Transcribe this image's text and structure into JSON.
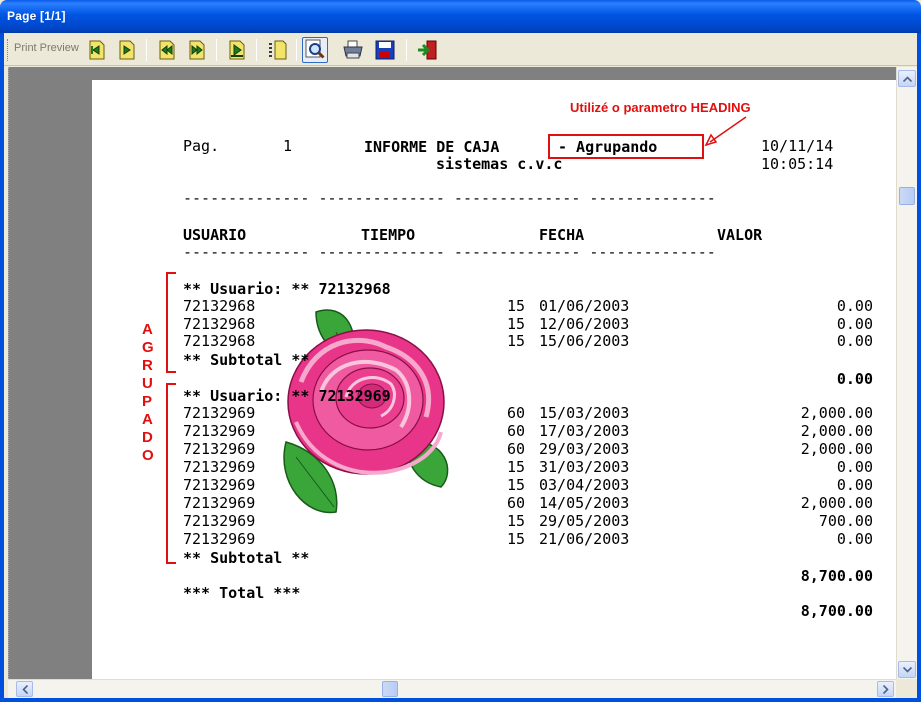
{
  "window": {
    "title": "Page [1/1]"
  },
  "toolbar": {
    "label": "Print Preview",
    "buttons": [
      {
        "name": "first-page-button",
        "icon": "page-first-icon"
      },
      {
        "name": "prev-page-button",
        "icon": "page-prev-icon"
      },
      {
        "name": "rewind-button",
        "icon": "rewind-icon"
      },
      {
        "name": "fast-forward-button",
        "icon": "fast-forward-icon"
      },
      {
        "name": "goto-page-button",
        "icon": "goto-page-icon"
      },
      {
        "name": "two-pages-button",
        "icon": "two-pages-icon"
      },
      {
        "name": "zoom-button",
        "icon": "magnifier-icon"
      },
      {
        "name": "print-button",
        "icon": "printer-icon"
      },
      {
        "name": "save-button",
        "icon": "floppy-disk-icon"
      },
      {
        "name": "exit-button",
        "icon": "exit-icon"
      }
    ]
  },
  "report": {
    "pag_label": "Pag.",
    "pag_number": "1",
    "title_prefix": "INFORME DE CAJA",
    "title_heading": "- Agrupando",
    "subtitle": "sistemas c.v.c",
    "date": "10/11/14",
    "time": "10:05:14",
    "dashes": "-------------- -------------- -------------- --------------",
    "columns": [
      "USUARIO",
      "TIEMPO",
      "FECHA",
      "VALOR"
    ],
    "groups": [
      {
        "header": "** Usuario: ** 72132968",
        "rows": [
          {
            "user": "72132968",
            "tiempo": "15",
            "fecha": "01/06/2003",
            "valor": "0.00"
          },
          {
            "user": "72132968",
            "tiempo": "15",
            "fecha": "12/06/2003",
            "valor": "0.00"
          },
          {
            "user": "72132968",
            "tiempo": "15",
            "fecha": "15/06/2003",
            "valor": "0.00"
          }
        ],
        "subtotal_label": "** Subtotal **",
        "subtotal_value": "0.00"
      },
      {
        "header": "** Usuario: ** 72132969",
        "rows": [
          {
            "user": "72132969",
            "tiempo": "60",
            "fecha": "15/03/2003",
            "valor": "2,000.00"
          },
          {
            "user": "72132969",
            "tiempo": "60",
            "fecha": "17/03/2003",
            "valor": "2,000.00"
          },
          {
            "user": "72132969",
            "tiempo": "60",
            "fecha": "29/03/2003",
            "valor": "2,000.00"
          },
          {
            "user": "72132969",
            "tiempo": "15",
            "fecha": "31/03/2003",
            "valor": "0.00"
          },
          {
            "user": "72132969",
            "tiempo": "15",
            "fecha": "03/04/2003",
            "valor": "0.00"
          },
          {
            "user": "72132969",
            "tiempo": "60",
            "fecha": "14/05/2003",
            "valor": "2,000.00"
          },
          {
            "user": "72132969",
            "tiempo": "15",
            "fecha": "29/05/2003",
            "valor": "700.00"
          },
          {
            "user": "72132969",
            "tiempo": "15",
            "fecha": "21/06/2003",
            "valor": "0.00"
          }
        ],
        "subtotal_label": "** Subtotal **",
        "subtotal_value": "8,700.00"
      }
    ],
    "total_label": "*** Total ***",
    "total_value": "8,700.00"
  },
  "annotations": {
    "heading_note": "Utilizé o parametro HEADING",
    "grouped_letters": [
      "A",
      "G",
      "R",
      "U",
      "P",
      "A",
      "D",
      "O"
    ],
    "color": "#e01010"
  }
}
